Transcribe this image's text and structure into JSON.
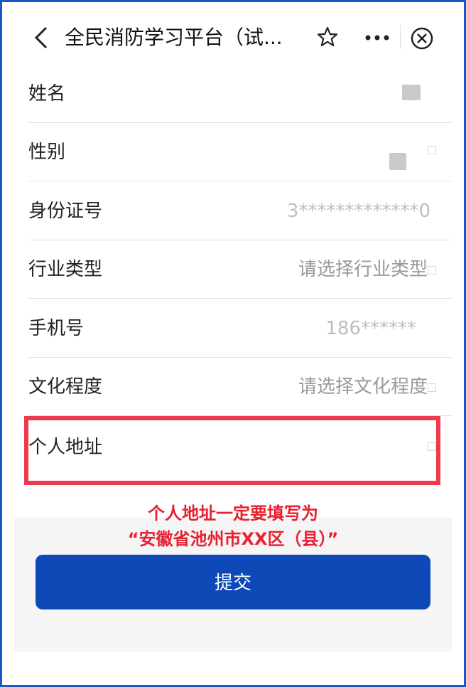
{
  "header": {
    "title": "全民消防学习平台（试...",
    "icons": [
      "back-icon",
      "star-icon",
      "more-icon",
      "close-icon"
    ]
  },
  "form": {
    "rows": [
      {
        "label": "姓名",
        "value": ""
      },
      {
        "label": "性别",
        "value": ""
      },
      {
        "label": "身份证号",
        "value": "3*************0"
      },
      {
        "label": "行业类型",
        "value": "请选择行业类型"
      },
      {
        "label": "手机号",
        "value": "186******"
      },
      {
        "label": "文化程度",
        "value": "请选择文化程度"
      },
      {
        "label": "个人地址",
        "value": ""
      }
    ]
  },
  "annotation": {
    "line1": "个人地址一定要填写为",
    "line2": "“安徽省池州市XX区（县）”",
    "color": "#e8202f"
  },
  "submit": {
    "label": "提交",
    "color": "#0f49b7"
  }
}
